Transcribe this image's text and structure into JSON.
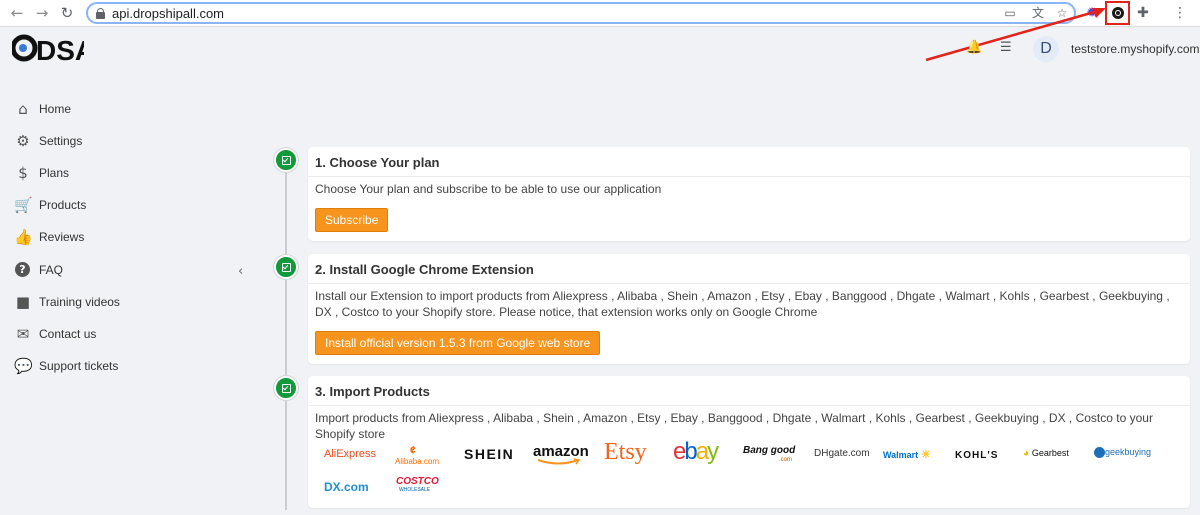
{
  "browser": {
    "url": "api.dropshipall.com",
    "nav": {
      "back": "←",
      "forward": "→",
      "reload": "↻"
    }
  },
  "header": {
    "logo_text": "DSA",
    "avatar_letter": "D",
    "store_name": "teststore.myshopify.com"
  },
  "sidebar": {
    "items": [
      {
        "label": "Home",
        "icon": "home-icon"
      },
      {
        "label": "Settings",
        "icon": "gears-icon"
      },
      {
        "label": "Plans",
        "icon": "dollar-icon"
      },
      {
        "label": "Products",
        "icon": "cart-icon"
      },
      {
        "label": "Reviews",
        "icon": "thumbs-up-icon"
      },
      {
        "label": "FAQ",
        "icon": "question-icon"
      },
      {
        "label": "Training videos",
        "icon": "video-icon"
      },
      {
        "label": "Contact us",
        "icon": "envelope-icon"
      },
      {
        "label": "Support tickets",
        "icon": "comments-icon"
      }
    ],
    "collapse_glyph": "‹"
  },
  "steps": [
    {
      "title": "1. Choose Your plan",
      "text": "Choose Your plan and subscribe to be able to use our application",
      "button": "Subscribe"
    },
    {
      "title": "2. Install Google Chrome Extension",
      "text": "Install our Extension to import products from Aliexpress , Alibaba , Shein , Amazon , Etsy , Ebay , Banggood , Dhgate , Walmart , Kohls , Gearbest , Geekbuying , DX , Costco to your Shopify store. Please notice, that extension works only on Google Chrome",
      "button": "Install official version 1.5.3 from Google web store"
    },
    {
      "title": "3. Import Products",
      "text": "Import products from Aliexpress , Alibaba , Shein , Amazon , Etsy , Ebay , Banggood , Dhgate , Walmart , Kohls , Gearbest , Geekbuying , DX , Costco to your Shopify store",
      "logos": {
        "aliexpress": "AliExpress",
        "alibaba": "Alibaba.com",
        "shein": "SHEIN",
        "amazon": "amazon",
        "etsy": "Etsy",
        "ebay_e": "e",
        "ebay_b": "b",
        "ebay_a": "a",
        "ebay_y": "y",
        "banggood": "Bang good",
        "banggood_com": ".com",
        "dhgate": "DHgate.com",
        "walmart": "Walmart",
        "kohls": "KOHL'S",
        "gearbest": "Gearbest",
        "geekbuying": "geekbuying",
        "dx": "DX.com",
        "costco": "COSTCO",
        "costco_sub": "WHOLESALE"
      }
    }
  ],
  "colors": {
    "accent_orange": "#f7941d",
    "check_green": "#109a3a",
    "annotation_red": "#e2231a"
  }
}
